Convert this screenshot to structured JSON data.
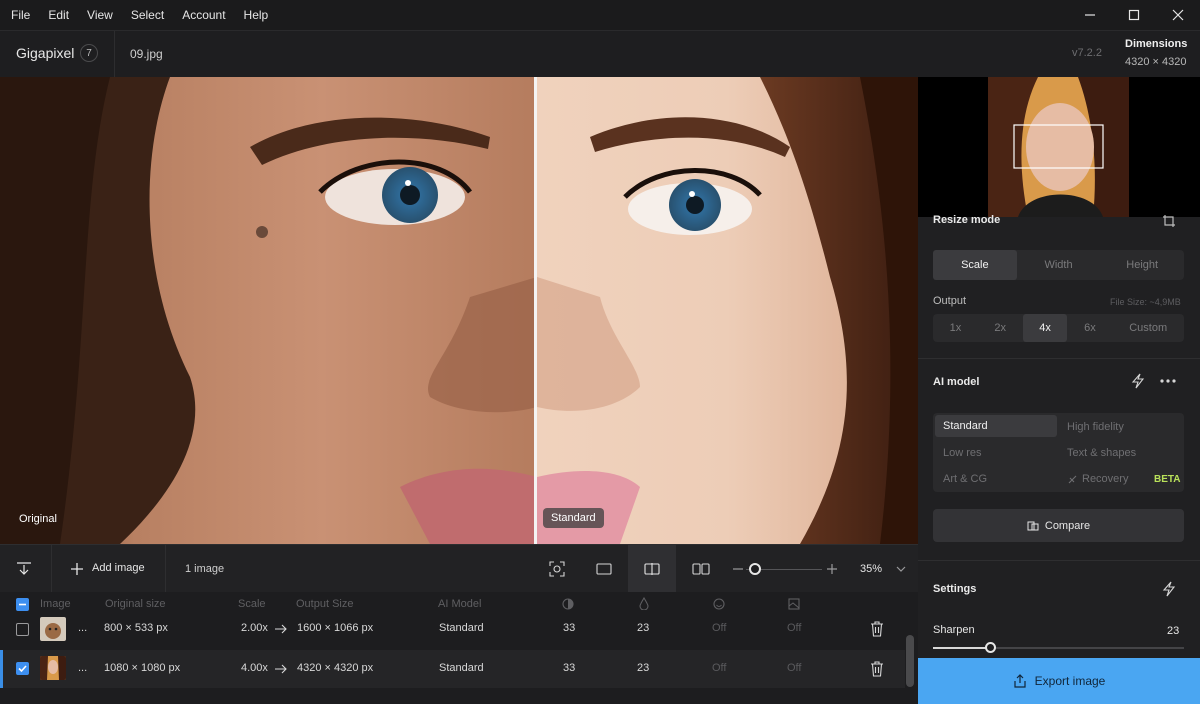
{
  "menu": [
    "File",
    "Edit",
    "View",
    "Select",
    "Account",
    "Help"
  ],
  "header": {
    "app_name": "Gigapixel",
    "badge": "7",
    "file_name": "09.jpg",
    "version": "v7.2.2",
    "dimensions_label": "Dimensions",
    "dimensions_value": "4320 × 4320"
  },
  "preview": {
    "left_label": "Original",
    "right_label": "Standard"
  },
  "right_panel": {
    "resize_mode_label": "Resize mode",
    "resize_tabs": [
      "Scale",
      "Width",
      "Height"
    ],
    "output_label": "Output",
    "file_size": "File Size: ~4,9MB",
    "scale_options": [
      "1x",
      "2x",
      "4x",
      "6x",
      "Custom"
    ],
    "ai_model_label": "AI model",
    "models": {
      "standard": "Standard",
      "high_fidelity": "High fidelity",
      "low_res": "Low res",
      "text_shapes": "Text & shapes",
      "art_cg": "Art & CG",
      "recovery": "Recovery",
      "beta": "BETA"
    },
    "compare_label": "Compare",
    "settings_label": "Settings",
    "sharpen_label": "Sharpen",
    "sharpen_value": "23",
    "sharpen_level": 0.23,
    "export_label": "Export image"
  },
  "toolbar": {
    "add_image": "Add image",
    "count": "1 image",
    "zoom": "35%"
  },
  "table": {
    "headers": {
      "image": "Image",
      "original_size": "Original size",
      "scale": "Scale",
      "output_size": "Output Size",
      "ai_model": "AI Model"
    },
    "rows": [
      {
        "name": "...",
        "original": "800 × 533 px",
        "scale": "2.00x",
        "output": "1600 × 1066 px",
        "model": "Standard",
        "v1": "33",
        "v2": "23",
        "v3": "Off",
        "v4": "Off",
        "checked": false
      },
      {
        "name": "...",
        "original": "1080 × 1080 px",
        "scale": "4.00x",
        "output": "4320 × 4320 px",
        "model": "Standard",
        "v1": "33",
        "v2": "23",
        "v3": "Off",
        "v4": "Off",
        "checked": true
      }
    ]
  },
  "colors": {
    "accent": "#4aa6f2",
    "beta": "#b9e15a",
    "checkbox": "#3d8ff0"
  }
}
